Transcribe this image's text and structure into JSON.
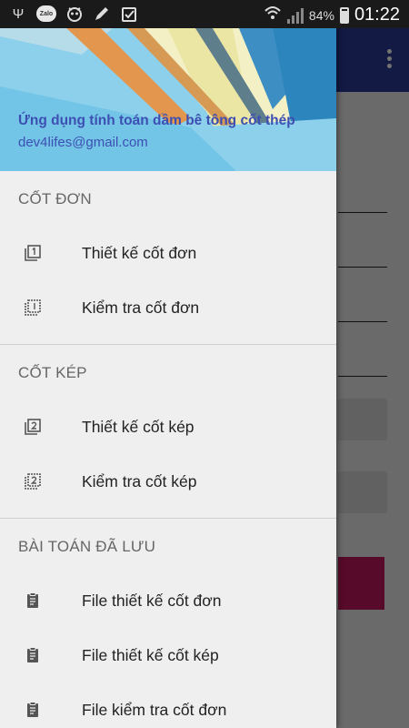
{
  "status_bar": {
    "left_icons": [
      "usb-icon",
      "zalo-icon",
      "app-icon",
      "pen-icon",
      "clipboard-icon"
    ],
    "zalo_label": "Zalo",
    "battery_percent": "84%",
    "time": "01:22"
  },
  "drawer": {
    "header": {
      "title": "Ứng dụng tính toán dầm bê tông cốt thép",
      "email": "dev4lifes@gmail.com"
    },
    "sections": [
      {
        "title": "CỐT ĐƠN",
        "items": [
          {
            "label": "Thiết kế cốt đơn",
            "icon": "filter-1-icon"
          },
          {
            "label": "Kiểm tra cốt đơn",
            "icon": "filter-1-outline-icon"
          }
        ]
      },
      {
        "title": "CỐT KÉP",
        "items": [
          {
            "label": "Thiết kế cốt kép",
            "icon": "filter-2-icon"
          },
          {
            "label": "Kiểm tra cốt kép",
            "icon": "filter-2-outline-icon"
          }
        ]
      },
      {
        "title": "BÀI TOÁN ĐÃ LƯU",
        "items": [
          {
            "label": "File thiết kế cốt đơn",
            "icon": "assignment-icon"
          },
          {
            "label": "File thiết kế cốt kép",
            "icon": "assignment-icon"
          },
          {
            "label": "File kiểm tra cốt đơn",
            "icon": "assignment-icon"
          }
        ]
      }
    ]
  },
  "colors": {
    "toolbar": "#2c3a97",
    "header_text": "#3d4fb3",
    "accent_button": "#c2185b"
  }
}
